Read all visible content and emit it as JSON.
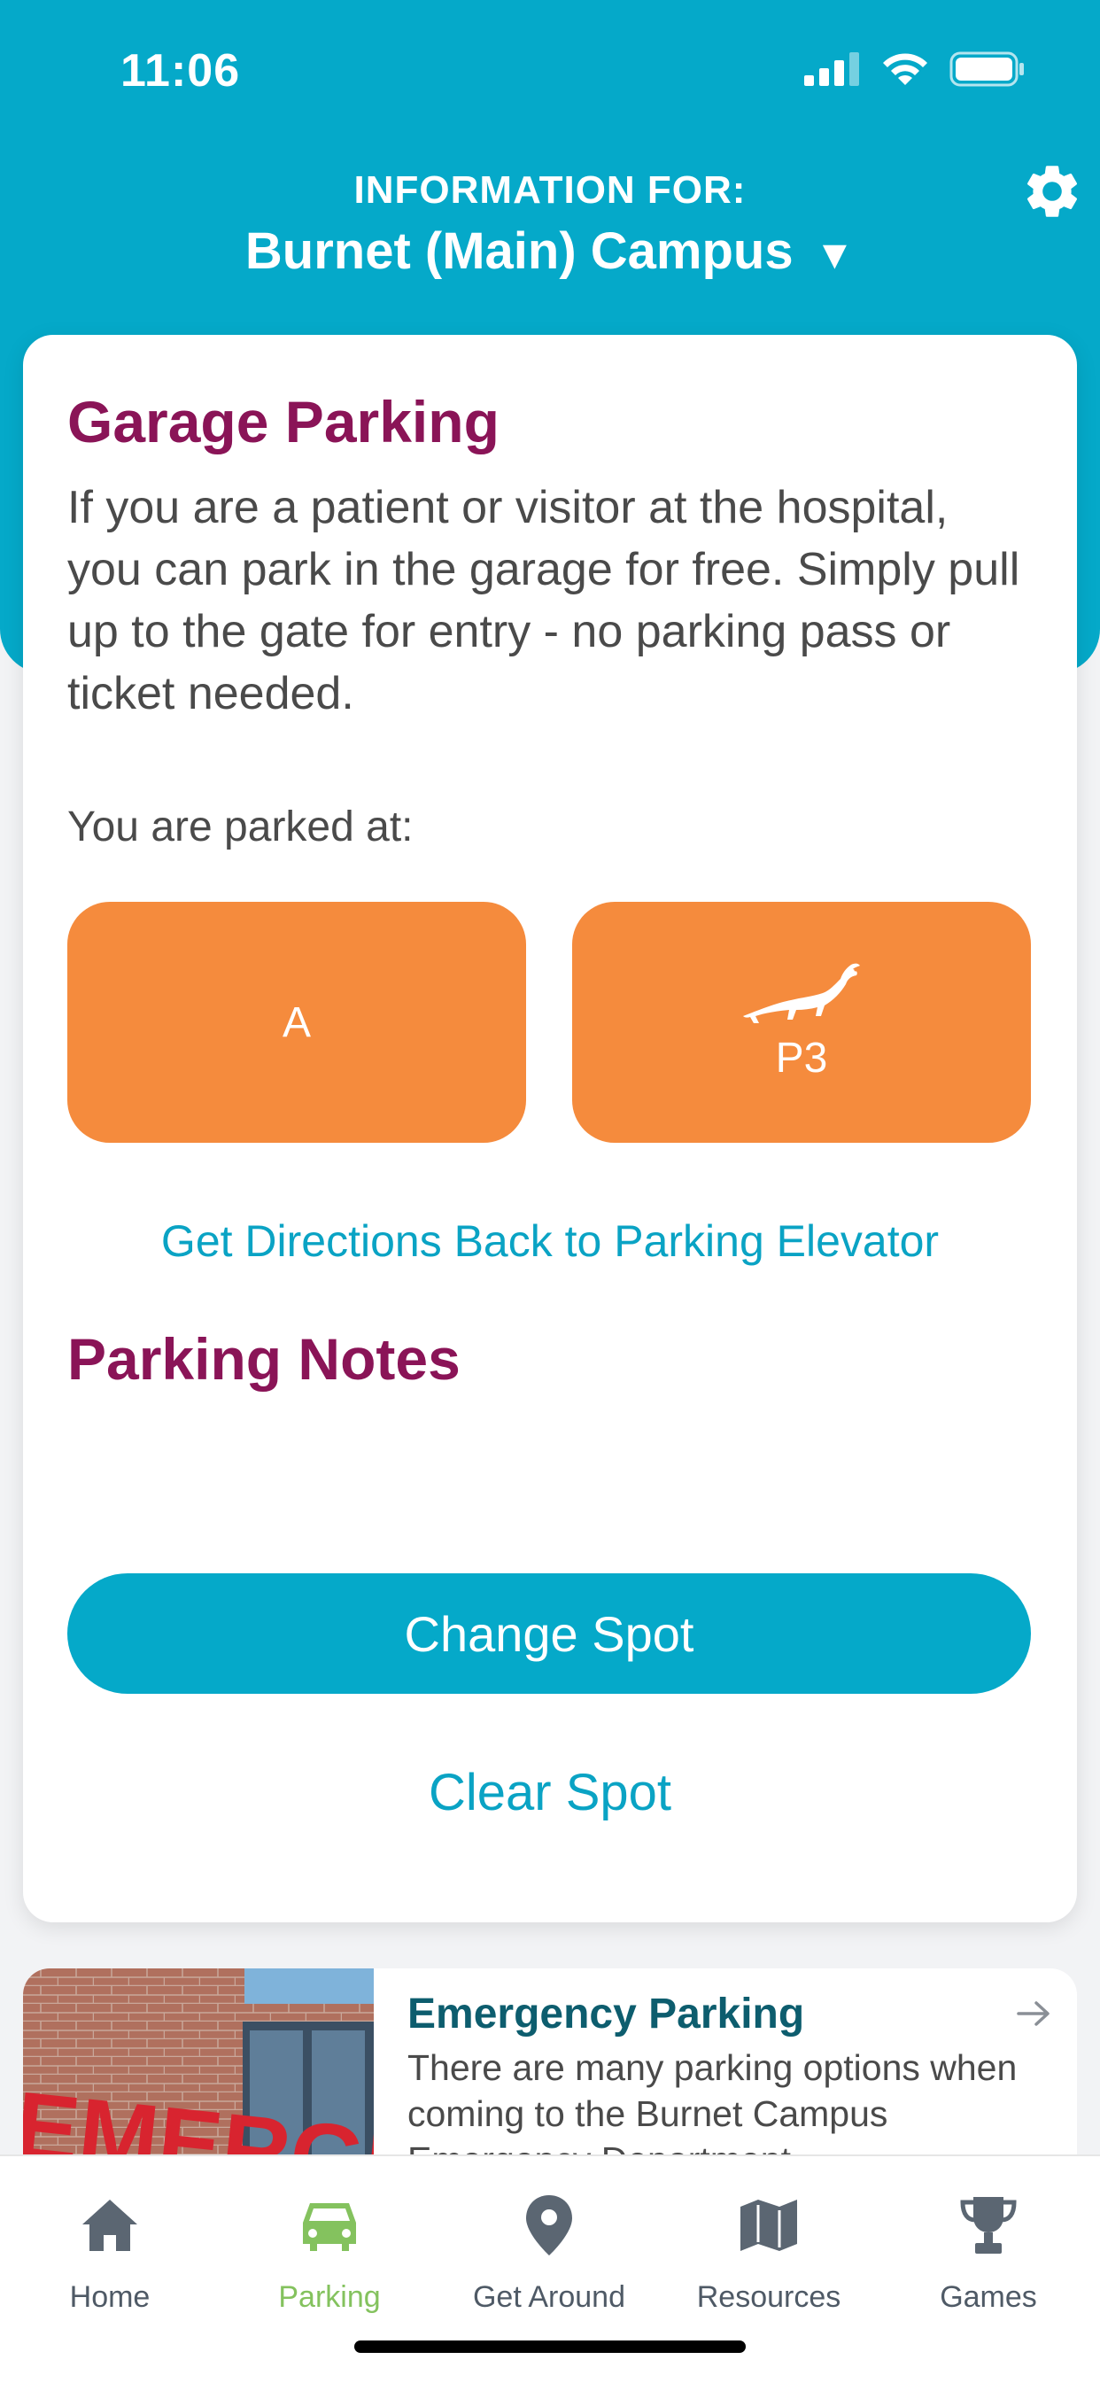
{
  "status_bar": {
    "time": "11:06"
  },
  "header": {
    "label": "INFORMATION FOR:",
    "campus": "Burnet (Main) Campus",
    "campus_caret": "▼",
    "settings_icon": "gear-icon"
  },
  "card": {
    "title": "Garage Parking",
    "description": "If you are a patient or visitor at the hospital, you can park in the garage for free. Simply pull up to the gate for entry - no parking pass or ticket needed.",
    "parked_label": "You are parked at:",
    "spot_section": "A",
    "spot_level": "P3",
    "spot_level_icon": "alligator-icon",
    "directions_link": "Get Directions Back to Parking Elevator",
    "notes_title": "Parking Notes",
    "change_button": "Change Spot",
    "clear_link": "Clear Spot"
  },
  "promo": {
    "image_text": "EMERGENCY",
    "title": "Emergency Parking",
    "description": "There are many parking options when coming to the Burnet Campus Emergency Department"
  },
  "tabs": [
    {
      "label": "Home",
      "icon": "home-icon"
    },
    {
      "label": "Parking",
      "icon": "car-icon",
      "active": true
    },
    {
      "label": "Get Around",
      "icon": "map-pin-icon"
    },
    {
      "label": "Resources",
      "icon": "map-icon"
    },
    {
      "label": "Games",
      "icon": "trophy-icon"
    }
  ],
  "colors": {
    "header": "#05a9c9",
    "title": "#8a1457",
    "spot_button": "#f58b3d",
    "link": "#0aa3c4",
    "active_tab": "#84c25e"
  }
}
